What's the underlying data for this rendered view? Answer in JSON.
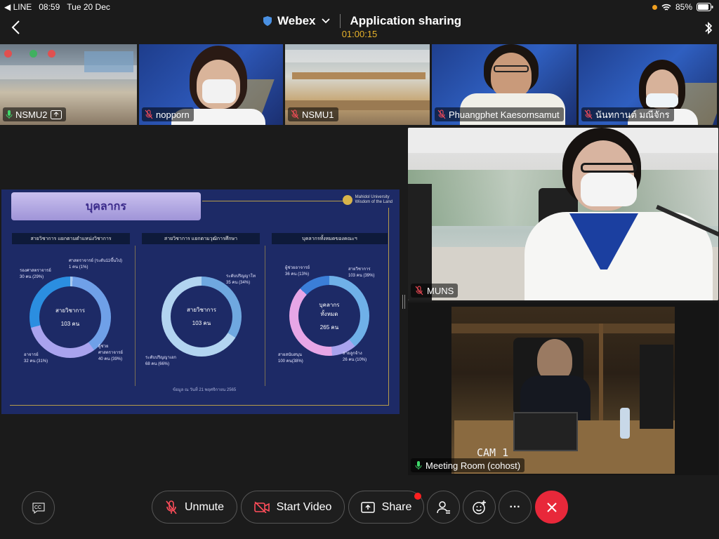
{
  "status": {
    "carrier": "◀ LINE",
    "time": "08:59",
    "date": "Tue 20 Dec",
    "battery": "85%"
  },
  "header": {
    "app_name": "Webex",
    "mode": "Application sharing",
    "timer": "01:00:15"
  },
  "thumbnails": [
    {
      "name": "NSMU2",
      "muted": false
    },
    {
      "name": "nopporn",
      "muted": true
    },
    {
      "name": "NSMU1",
      "muted": true
    },
    {
      "name": "Phuangphet Kaesornsamut",
      "muted": true
    },
    {
      "name": "นันทกานต์ มณีจักร",
      "muted": true
    }
  ],
  "slide": {
    "title": "บุคลากร",
    "logo_name": "Mahidol University",
    "logo_sub": "Wisdom of the Land",
    "columns": [
      {
        "header": "สายวิชาการ แยกตามตำแหน่งวิชาการ",
        "center_line1": "สายวิชาการ",
        "center_line2": "103 คน",
        "labels": [
          "รองศาสตราจารย์\n30 คน (29%)",
          "ศาสตราจารย์ (ระดับ11ขึ้นไป)\n1 คน (1%)",
          "ผู้ช่วย\nศาสตราจารย์\n40 คน (39%)",
          "อาจารย์\n32 คน (31%)"
        ]
      },
      {
        "header": "สายวิชาการ แยกตามวุฒิการศึกษา",
        "center_line1": "สายวิชาการ",
        "center_line2": "103 คน",
        "labels": [
          "ระดับปริญญาโท\n35 คน (34%)",
          "ระดับปริญญาเอก\n68 คน (66%)"
        ]
      },
      {
        "header": "บุคลากรทั้งหมดของคณะฯ",
        "center_line1": "บุคลากร\nทั้งหมด",
        "center_line2": "265 คน",
        "labels": [
          "ผู้ช่วยอาจารย์\n36 คน (13%)",
          "สายวิชาการ\n103 คน (39%)",
          "สายลูกจ้าง\n26 คน (10%)",
          "สายสนับสนุน\n100 คน(38%)"
        ]
      }
    ],
    "footnote": "ข้อมูล ณ วันที่ 21 พฤศจิกายน 2565"
  },
  "videos": {
    "main_name": "MUNS",
    "room_name": "Meeting Room (cohost)",
    "cam_label": "CAM 1"
  },
  "toolbar": {
    "cc": "CC",
    "unmute": "Unmute",
    "start_video": "Start Video",
    "share": "Share",
    "more": "···"
  }
}
